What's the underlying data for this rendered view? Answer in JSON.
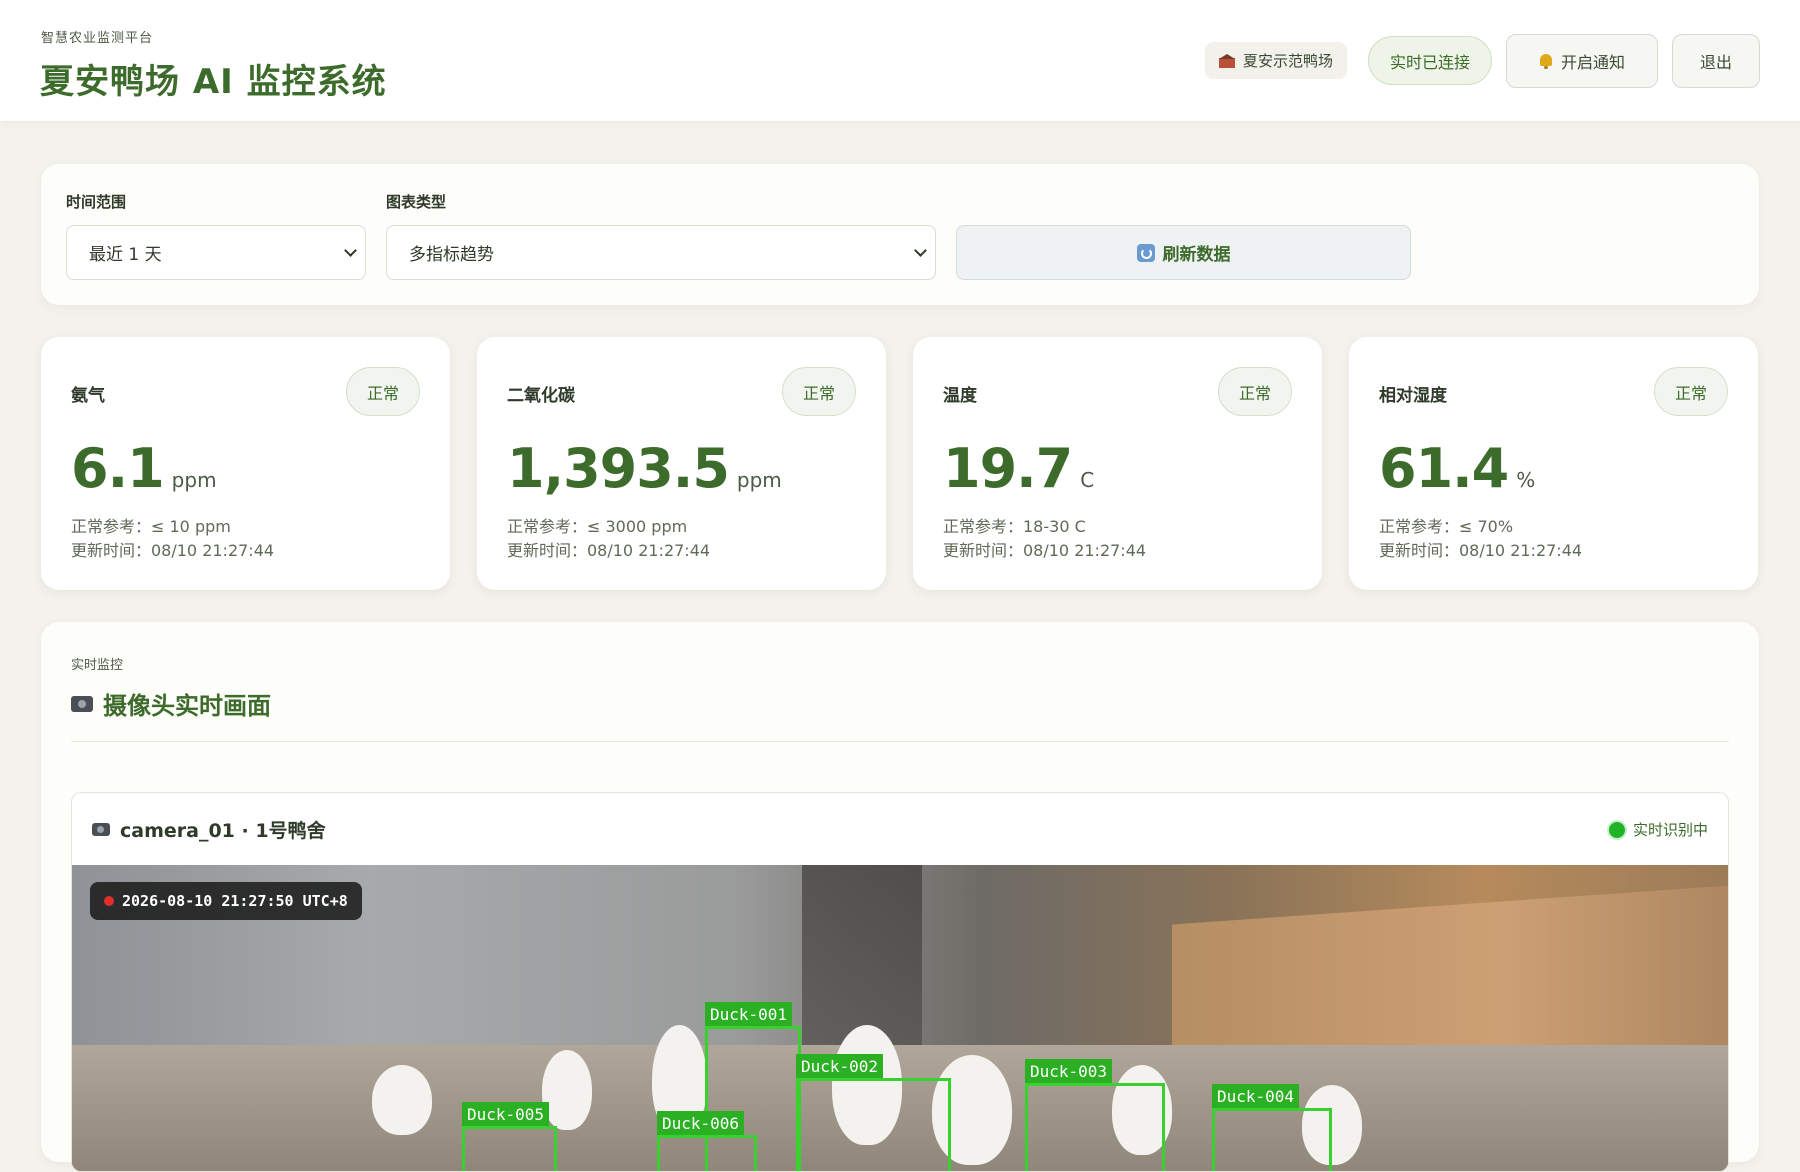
{
  "header": {
    "subtitle": "智慧农业监测平台",
    "title": "夏安鸭场 AI 监控系统",
    "farm_tag": "夏安示范鸭场",
    "connection": "实时已连接",
    "notify_label": "开启通知",
    "logout_label": "退出"
  },
  "filters": {
    "time_range_label": "时间范围",
    "time_range_value": "最近 1 天",
    "chart_type_label": "图表类型",
    "chart_type_value": "多指标趋势",
    "refresh_label": "刷新数据"
  },
  "metrics": [
    {
      "name": "氨气",
      "status": "正常",
      "value": "6.1",
      "unit": "ppm",
      "reference": "正常参考：≤ 10 ppm",
      "updated": "更新时间：08/10 21:27:44"
    },
    {
      "name": "二氧化碳",
      "status": "正常",
      "value": "1,393.5",
      "unit": "ppm",
      "reference": "正常参考：≤ 3000 ppm",
      "updated": "更新时间：08/10 21:27:44"
    },
    {
      "name": "温度",
      "status": "正常",
      "value": "19.7",
      "unit": "C",
      "reference": "正常参考：18-30 C",
      "updated": "更新时间：08/10 21:27:44"
    },
    {
      "name": "相对湿度",
      "status": "正常",
      "value": "61.4",
      "unit": "%",
      "reference": "正常参考：≤ 70%",
      "updated": "更新时间：08/10 21:27:44"
    }
  ],
  "monitor": {
    "subtitle": "实时监控",
    "title": "摄像头实时画面",
    "camera_name": "camera_01 · 1号鸭舍",
    "camera_status": "实时识别中",
    "timestamp": "2026-08-10 21:27:50 UTC+8",
    "detections": [
      "Duck-001",
      "Duck-002",
      "Duck-003",
      "Duck-004",
      "Duck-005",
      "Duck-006"
    ]
  },
  "icons": {
    "farm": "barn-icon",
    "notify": "bell-icon",
    "refresh": "refresh-icon",
    "camera": "video-camera-icon",
    "status": "green-dot-icon"
  },
  "colors": {
    "brand_green": "#3d6b2b",
    "background": "#f4f2ec",
    "detection_green": "#39d12f",
    "live_dot": "#20b327",
    "rec_dot": "#e0302a"
  }
}
